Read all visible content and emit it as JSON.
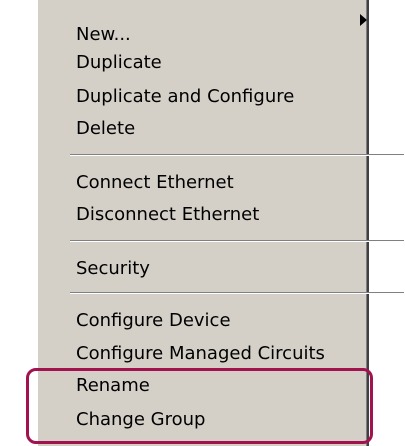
{
  "menu": {
    "items": [
      {
        "label": "New...",
        "has_submenu": true
      },
      {
        "label": "Duplicate"
      },
      {
        "label": "Duplicate and Configure"
      },
      {
        "label": "Delete"
      },
      {
        "label": "Connect Ethernet"
      },
      {
        "label": "Disconnect Ethernet"
      },
      {
        "label": "Security"
      },
      {
        "label": "Configure Device"
      },
      {
        "label": "Configure Managed Circuits"
      },
      {
        "label": "Rename"
      },
      {
        "label": "Change Group"
      }
    ]
  },
  "annotation": {
    "highlight_color": "#a1124f",
    "highlighted_items": [
      "Rename",
      "Change Group"
    ]
  }
}
